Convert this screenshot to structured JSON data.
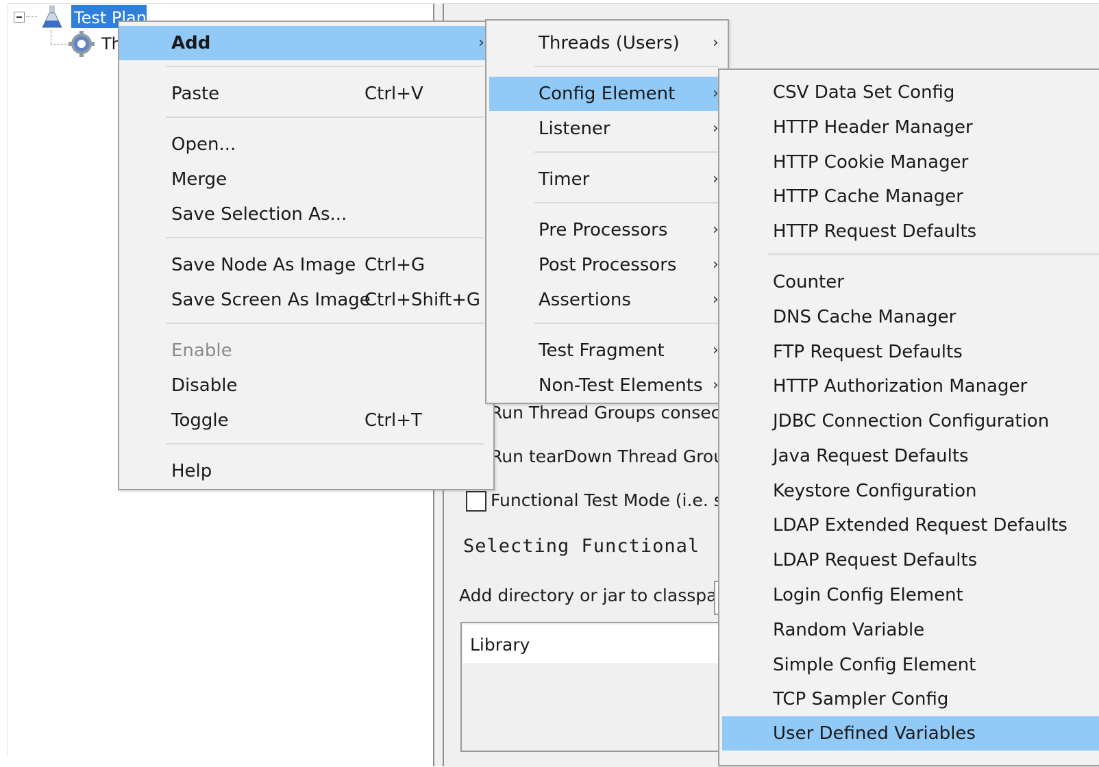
{
  "tree": {
    "selected_node": "Test Plan",
    "child_node": "Th"
  },
  "background": {
    "run_consecutive": "Run Thread Groups consecuti",
    "run_teardown": "Run tearDown Thread Groups",
    "functional_mode": "Functional Test Mode (i.e. sav",
    "selecting_functional": "Selecting Functional",
    "add_classpath": "Add directory or jar to classpath",
    "library_header": "Library"
  },
  "menu_main": {
    "add": "Add",
    "paste": "Paste",
    "paste_shortcut": "Ctrl+V",
    "open": "Open...",
    "merge": "Merge",
    "save_selection": "Save Selection As...",
    "save_node_image": "Save Node As Image",
    "save_node_image_shortcut": "Ctrl+G",
    "save_screen_image": "Save Screen As Image",
    "save_screen_image_shortcut": "Ctrl+Shift+G",
    "enable": "Enable",
    "disable": "Disable",
    "toggle": "Toggle",
    "toggle_shortcut": "Ctrl+T",
    "help": "Help"
  },
  "menu_add": {
    "threads": "Threads (Users)",
    "config_element": "Config Element",
    "listener": "Listener",
    "timer": "Timer",
    "pre_processors": "Pre Processors",
    "post_processors": "Post Processors",
    "assertions": "Assertions",
    "test_fragment": "Test Fragment",
    "non_test_elements": "Non-Test Elements"
  },
  "menu_config": {
    "items": [
      "CSV Data Set Config",
      "HTTP Header Manager",
      "HTTP Cookie Manager",
      "HTTP Cache Manager",
      "HTTP Request Defaults",
      "Counter",
      "DNS Cache Manager",
      "FTP Request Defaults",
      "HTTP Authorization Manager",
      "JDBC Connection Configuration",
      "Java Request Defaults",
      "Keystore Configuration",
      "LDAP Extended Request Defaults",
      "LDAP Request Defaults",
      "Login Config Element",
      "Random Variable",
      "Simple Config Element",
      "TCP Sampler Config",
      "User Defined Variables"
    ]
  },
  "submenu_arrow": "›",
  "colors": {
    "selection": "#2f7fdb",
    "menu_highlight": "#91c9f7",
    "menu_bg": "#f2f2f2"
  }
}
